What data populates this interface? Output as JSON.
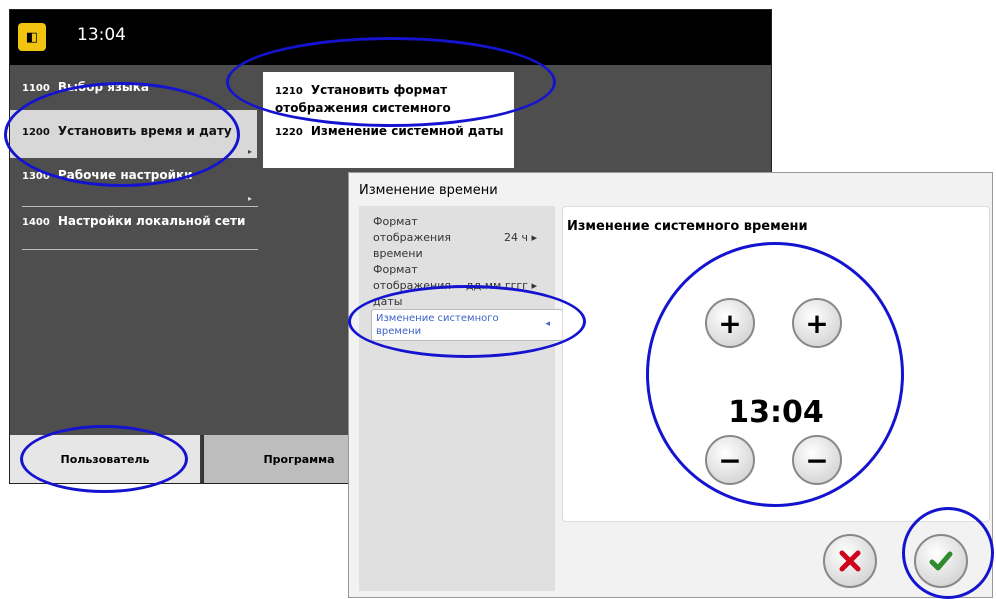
{
  "back_window": {
    "clock": "13:04",
    "app_icon": "app-logo-icon",
    "menu": [
      {
        "code": "1100",
        "label": "Выбор языка"
      },
      {
        "code": "1200",
        "label": "Установить время и дату"
      },
      {
        "code": "1300",
        "label": "Рабочие настройки"
      },
      {
        "code": "1400",
        "label": "Настройки локальной сети"
      }
    ],
    "submenu": [
      {
        "code": "1210",
        "label": "Установить формат отображения системного"
      },
      {
        "code": "1220",
        "label": "Изменение системной даты"
      }
    ],
    "tabs": [
      {
        "label": "Пользователь"
      },
      {
        "label": "Программа"
      }
    ]
  },
  "dialog": {
    "title": "Изменение времени",
    "options": [
      {
        "label": "Формат отображения времени",
        "value": "24 ч"
      },
      {
        "label": "Формат отображения даты",
        "value": "дд.мм.гггг"
      },
      {
        "label": "Изменение системного времени"
      }
    ],
    "panel_title": "Изменение системного времени",
    "time": "13:04",
    "plus": "+",
    "minus": "−"
  },
  "colors": {
    "annotation": "#1414d0",
    "cancel": "#d0021b",
    "confirm": "#2e8b2e"
  }
}
